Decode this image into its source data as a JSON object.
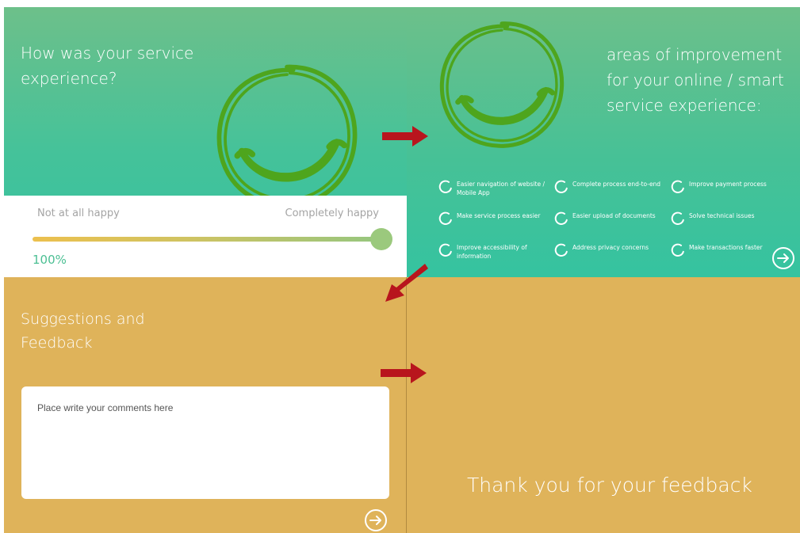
{
  "panel_rating": {
    "title": "How was your service experience?",
    "scale_low": "Not at all happy",
    "scale_high": "Completely happy",
    "rating_value": 1.0,
    "rating_text": "100%"
  },
  "panel_improvement": {
    "title": "areas of improvement for your online / smart service experience:",
    "options": [
      "Easier navigation of website / Mobile App",
      "Complete process end-to-end",
      "Improve payment process",
      "Make service process easier",
      "Easier upload of documents",
      "Solve technical issues",
      "Improve accessibility of information",
      "Address privacy concerns",
      "Make transactions faster"
    ]
  },
  "panel_feedback": {
    "title": "Suggestions and Feedback",
    "placeholder": "Place write your comments here"
  },
  "panel_thanks": {
    "message": "Thank you for your feedback"
  },
  "icons": {
    "smiley": "smiley-face-icon",
    "next": "arrow-right-circle-icon",
    "option": "circle-loader-icon",
    "flow_arrow": "red-flow-arrow-icon"
  },
  "colors": {
    "green_top": "#6dc08a",
    "green_bottom": "#35c3a0",
    "gold": "#dfb35a",
    "smiley": "#4ea51d",
    "flow_arrow": "#b8151d"
  }
}
